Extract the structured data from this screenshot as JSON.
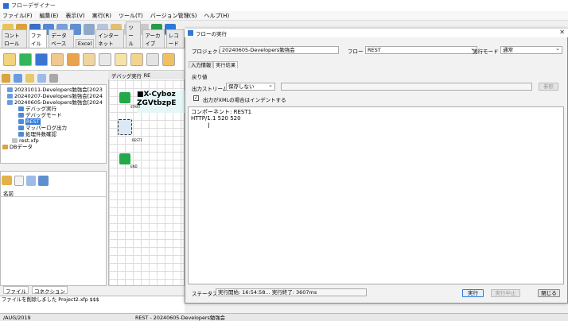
{
  "window": {
    "title": "フローデザイナー",
    "menu": [
      "ファイル(F)",
      "編集(E)",
      "表示(V)",
      "実行(R)",
      "ツール(T)",
      "バージョン管理(S)",
      "ヘルプ(H)"
    ]
  },
  "left_tabs": [
    "コントロール",
    "ファイル",
    "データベース",
    "Excel",
    "インターネット",
    "ツール",
    "アーカイブ",
    "レコード"
  ],
  "tree": [
    {
      "label": "20231011-Developers勉強会[2023",
      "indent": 2,
      "selected": false
    },
    {
      "label": "20240207-Developers勉強会[2024",
      "indent": 2,
      "selected": false
    },
    {
      "label": "20240605-Developers勉強会[2024",
      "indent": 2,
      "selected": false
    },
    {
      "label": "デバッグ実行",
      "indent": 4,
      "selected": false
    },
    {
      "label": "デバッグモード",
      "indent": 4,
      "selected": false
    },
    {
      "label": "REST",
      "indent": 4,
      "selected": true
    },
    {
      "label": "マッパーログ出力",
      "indent": 4,
      "selected": false
    },
    {
      "label": "処理件数確認",
      "indent": 4,
      "selected": false
    },
    {
      "label": "rest.xfp",
      "indent": 3,
      "selected": false
    },
    {
      "label": "DBデータ",
      "indent": 0,
      "selected": false
    }
  ],
  "files_panel": {
    "column_header": "名前"
  },
  "bottom_tabs": [
    "ファイル",
    "コネクション"
  ],
  "log_lines": [
    "ファイルを削除しました  Project2.xfp $$$"
  ],
  "statusbar": {
    "left": "/AUG/2019",
    "center": "REST - 20240605-Developers勉強会"
  },
  "canvas": {
    "tabs": [
      "デバッグ実行",
      "RE"
    ],
    "overlay_lines": [
      "■X-Cyboz",
      "ZGVtbzpE"
    ],
    "node_labels": [
      "START",
      "REST1",
      "END"
    ]
  },
  "dialog": {
    "title": "フローの実行",
    "project_label": "プロジェクト",
    "project_value": "20240605-Developers勉強会",
    "flow_label": "フロー",
    "flow_value": "REST",
    "mode_label": "実行モード",
    "mode_value": "通常",
    "tabs": [
      "入力情報",
      "実行結果"
    ],
    "return_label": "戻り値",
    "stream_label": "出力ストリーム",
    "stream_value": "保存しない",
    "browse_button": "参照",
    "indent_checkbox_label": "出力がXMLの場合はインデントする",
    "indent_checked": true,
    "result_lines": [
      "コンポーネント: REST1",
      "HTTP/1.1 520 520"
    ],
    "status_label": "ステータス",
    "status_value": "実行開始: 16:54:58... 実行終了: 3607ms",
    "buttons": {
      "run": "実行",
      "stop": "実行中止",
      "close": "閉じる"
    }
  },
  "colors": {
    "accent": "#3178d6",
    "start_node": "#22a94a",
    "canvas_teal": "#00a0a0"
  }
}
